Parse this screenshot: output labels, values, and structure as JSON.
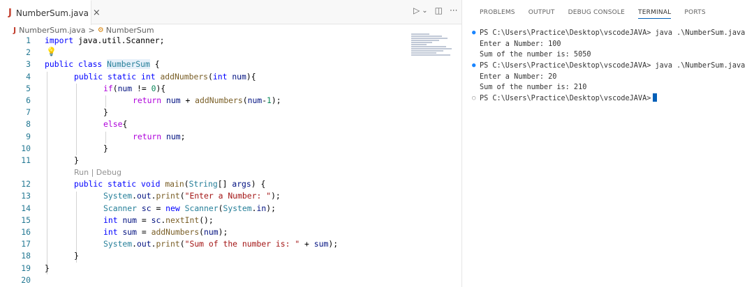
{
  "editor": {
    "tab": {
      "label": "NumberSum.java",
      "close": "×"
    },
    "actions": {
      "run": "▷",
      "run_menu": "⌄",
      "split": "◫",
      "more": "···"
    },
    "breadcrumb": {
      "file": "NumberSum.java",
      "separator": ">",
      "symbol": "NumberSum"
    },
    "codelens": "Run | Debug",
    "lines": [
      {
        "n": "1"
      },
      {
        "n": "2"
      },
      {
        "n": "3"
      },
      {
        "n": "4"
      },
      {
        "n": "5"
      },
      {
        "n": "6"
      },
      {
        "n": "7"
      },
      {
        "n": "8"
      },
      {
        "n": "9"
      },
      {
        "n": "10"
      },
      {
        "n": "11"
      },
      {
        "n": "12"
      },
      {
        "n": "13"
      },
      {
        "n": "14"
      },
      {
        "n": "15"
      },
      {
        "n": "16"
      },
      {
        "n": "17"
      },
      {
        "n": "18"
      },
      {
        "n": "19"
      },
      {
        "n": "20"
      }
    ],
    "code": {
      "l1_kw": "import",
      "l1_rest": " java.util.Scanner;",
      "l3_kw": "public class",
      "l3_cls": "NumberSum",
      "l3_rest": " {",
      "l4_kw": "public static int",
      "l4_fn": "addNumbers",
      "l4_p1": "(",
      "l4_type": "int",
      "l4_var": "num",
      "l4_p2": "){",
      "l5_ctrl": "if",
      "l5_p1": "(",
      "l5_var": "num",
      "l5_op": " != ",
      "l5_num": "0",
      "l5_p2": "){",
      "l6_ctrl": "return",
      "l6_var": "num",
      "l6_op": " + ",
      "l6_fn": "addNumbers",
      "l6_p1": "(",
      "l6_var2": "num",
      "l6_op2": "-",
      "l6_num": "1",
      "l6_p2": ");",
      "l7": "}",
      "l8_ctrl": "else",
      "l8_p": "{",
      "l9_ctrl": "return",
      "l9_var": "num",
      "l9_p": ";",
      "l10": "}",
      "l11": "}",
      "l12_kw": "public static void",
      "l12_fn": "main",
      "l12_p1": "(",
      "l12_type": "String",
      "l12_p2": "[] ",
      "l12_var": "args",
      "l12_p3": ") {",
      "l13_type": "System",
      "l13_p1": ".",
      "l13_var": "out",
      "l13_p2": ".",
      "l13_fn": "print",
      "l13_p3": "(",
      "l13_str": "\"Enter a Number: \"",
      "l13_p4": ");",
      "l14_type": "Scanner",
      "l14_var": "sc",
      "l14_op": " = ",
      "l14_kw": "new",
      "l14_type2": "Scanner",
      "l14_p1": "(",
      "l14_type3": "System",
      "l14_p2": ".",
      "l14_var2": "in",
      "l14_p3": ");",
      "l15_type": "int",
      "l15_var": "num",
      "l15_op": " = ",
      "l15_var2": "sc",
      "l15_p1": ".",
      "l15_fn": "nextInt",
      "l15_p2": "();",
      "l16_type": "int",
      "l16_var": "sum",
      "l16_op": " = ",
      "l16_fn": "addNumbers",
      "l16_p1": "(",
      "l16_var2": "num",
      "l16_p2": ");",
      "l17_type": "System",
      "l17_p1": ".",
      "l17_var": "out",
      "l17_p2": ".",
      "l17_fn": "print",
      "l17_p3": "(",
      "l17_str": "\"Sum of the number is: \"",
      "l17_op": " + ",
      "l17_var2": "sum",
      "l17_p4": ");",
      "l18": "}",
      "l19": "}"
    }
  },
  "panel": {
    "tabs": [
      "PROBLEMS",
      "OUTPUT",
      "DEBUG CONSOLE",
      "TERMINAL",
      "PORTS"
    ],
    "active_tab": "TERMINAL",
    "terminal": [
      {
        "marker": "●",
        "text": "PS C:\\Users\\Practice\\Desktop\\vscodeJAVA> java .\\NumberSum.java"
      },
      {
        "marker": "",
        "text": "Enter a Number: 100"
      },
      {
        "marker": "",
        "text": "Sum of the number is: 5050"
      },
      {
        "marker": "●",
        "text": "PS C:\\Users\\Practice\\Desktop\\vscodeJAVA> java .\\NumberSum.java"
      },
      {
        "marker": "",
        "text": "Enter a Number: 20"
      },
      {
        "marker": "",
        "text": "Sum of the number is: 210"
      },
      {
        "marker": "○",
        "text": "PS C:\\Users\\Practice\\Desktop\\vscodeJAVA>"
      }
    ]
  },
  "colors": {
    "accent": "#005fb8",
    "line_number": "#237893",
    "keyword": "#0000ff",
    "control": "#af00db",
    "type": "#267f99",
    "function": "#795e26",
    "string": "#a31515"
  }
}
